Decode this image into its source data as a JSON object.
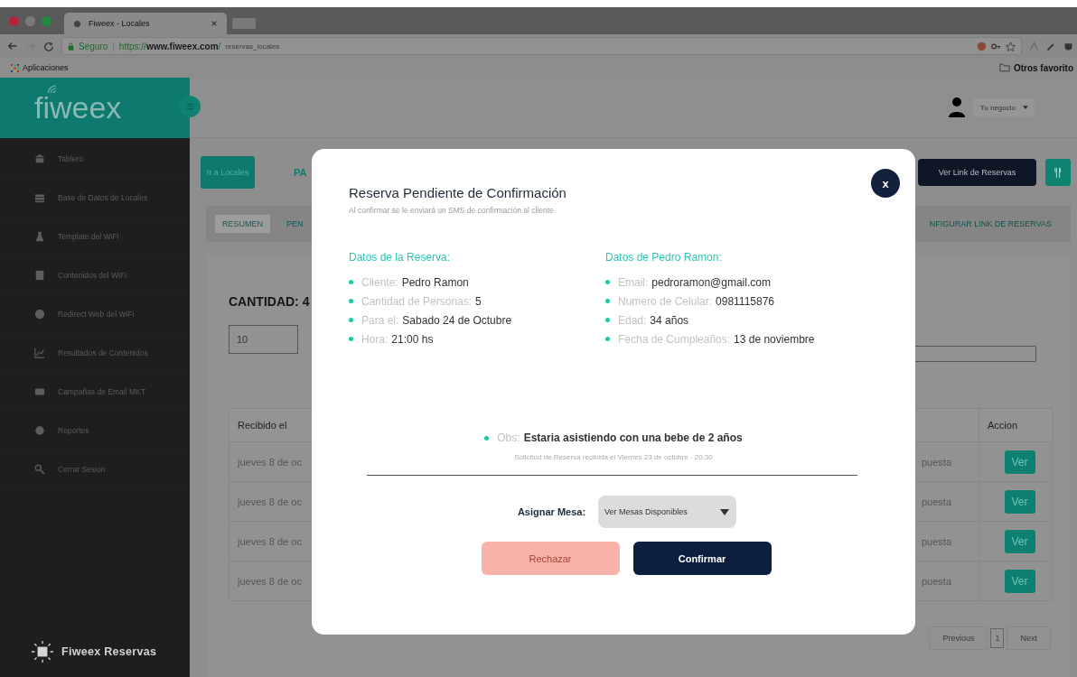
{
  "browser": {
    "tab_title": "Fiweex - Locales",
    "secure_label": "Seguro",
    "separator": "|",
    "url": "https://**www.fiweex.com**/",
    "url_path": "reservas_locales",
    "apps_bookmark": "Aplicaciones",
    "other_bookmarks": "Otros favorito"
  },
  "header": {
    "logo": "fiweex",
    "user_menu": "Tu negocio"
  },
  "sidebar": {
    "items": [
      {
        "label": "Tablero"
      },
      {
        "label": "Base de Datos de Locales"
      },
      {
        "label": "Template del WiFi"
      },
      {
        "label": "Contenidos del WiFi"
      },
      {
        "label": "Redirect Web del WiFi"
      },
      {
        "label": "Resultados de Contenidos"
      },
      {
        "label": "Campañas de Email MKT"
      },
      {
        "label": "Reportes"
      },
      {
        "label": "Cerrar Sesion"
      }
    ],
    "footer": "Fiweex Reservas"
  },
  "toolbar": {
    "back_button": "Ir a Locales",
    "section_title": "PA",
    "link_button": "Ver Link de Reservas"
  },
  "subtabs": [
    {
      "label": "RESUMEN",
      "selected": true
    },
    {
      "label": "PEN",
      "selected": false
    },
    {
      "label": "NFIGURAR LINK DE RESERVAS",
      "selected": false
    }
  ],
  "summary": {
    "count": "CANTIDAD: 4",
    "page_size": "10"
  },
  "table": {
    "columns": [
      "Recibido el",
      "Accion"
    ],
    "rows": [
      {
        "received": "jueves 8 de oc",
        "column_2": "puesta",
        "action": "Ver"
      },
      {
        "received": "jueves 8 de oc",
        "column_2": "puesta",
        "action": "Ver"
      },
      {
        "received": "jueves 8 de oc",
        "column_2": "puesta",
        "action": "Ver"
      },
      {
        "received": "jueves 8 de oc",
        "column_2": "puesta",
        "action": "Ver"
      }
    ]
  },
  "pagination": [
    {
      "label": "Previous",
      "selected": false
    },
    {
      "label": "1",
      "selected": true
    },
    {
      "label": "Next",
      "selected": false
    }
  ],
  "modal": {
    "title": "Reserva Pendiente de Confirmación",
    "close": "x",
    "subtitle": "Al confirmar se le enviará un SMS de confirmación al cliente",
    "sections": [
      {
        "heading": "Datos de la Reserva:",
        "items": [
          {
            "label": "Cliente:",
            "value": "Pedro Ramon"
          },
          {
            "label": "Cantidad de Personas:",
            "value": "5"
          },
          {
            "label": "Para el:",
            "value": "Sabado 24 de Octubre"
          },
          {
            "label": "Hora:",
            "value": "21:00 hs"
          }
        ]
      },
      {
        "heading": "Datos de Pedro Ramon:",
        "items": [
          {
            "label": "Email:",
            "value": "pedroramon@gmail.com"
          },
          {
            "label": "Numero de Celular:",
            "value": "0981115876"
          },
          {
            "label": "Edad:",
            "value": "34 años"
          },
          {
            "label": "Fecha de Cumpleaños:",
            "value": "13 de noviembre"
          }
        ]
      }
    ],
    "note": {
      "label": "Obs:",
      "value": "Estaria asistiendo con una bebe de 2 años"
    },
    "received": "Solicitud de Reserva recibida el Viernes 23 de octubre - 20:30",
    "assign": {
      "label": "Asignar Mesa:",
      "select": "Ver Mesas Disponibles"
    },
    "buttons": [
      {
        "label": "Rechazar",
        "kind": "reject"
      },
      {
        "label": "Confirmar",
        "kind": "confirm"
      }
    ]
  }
}
